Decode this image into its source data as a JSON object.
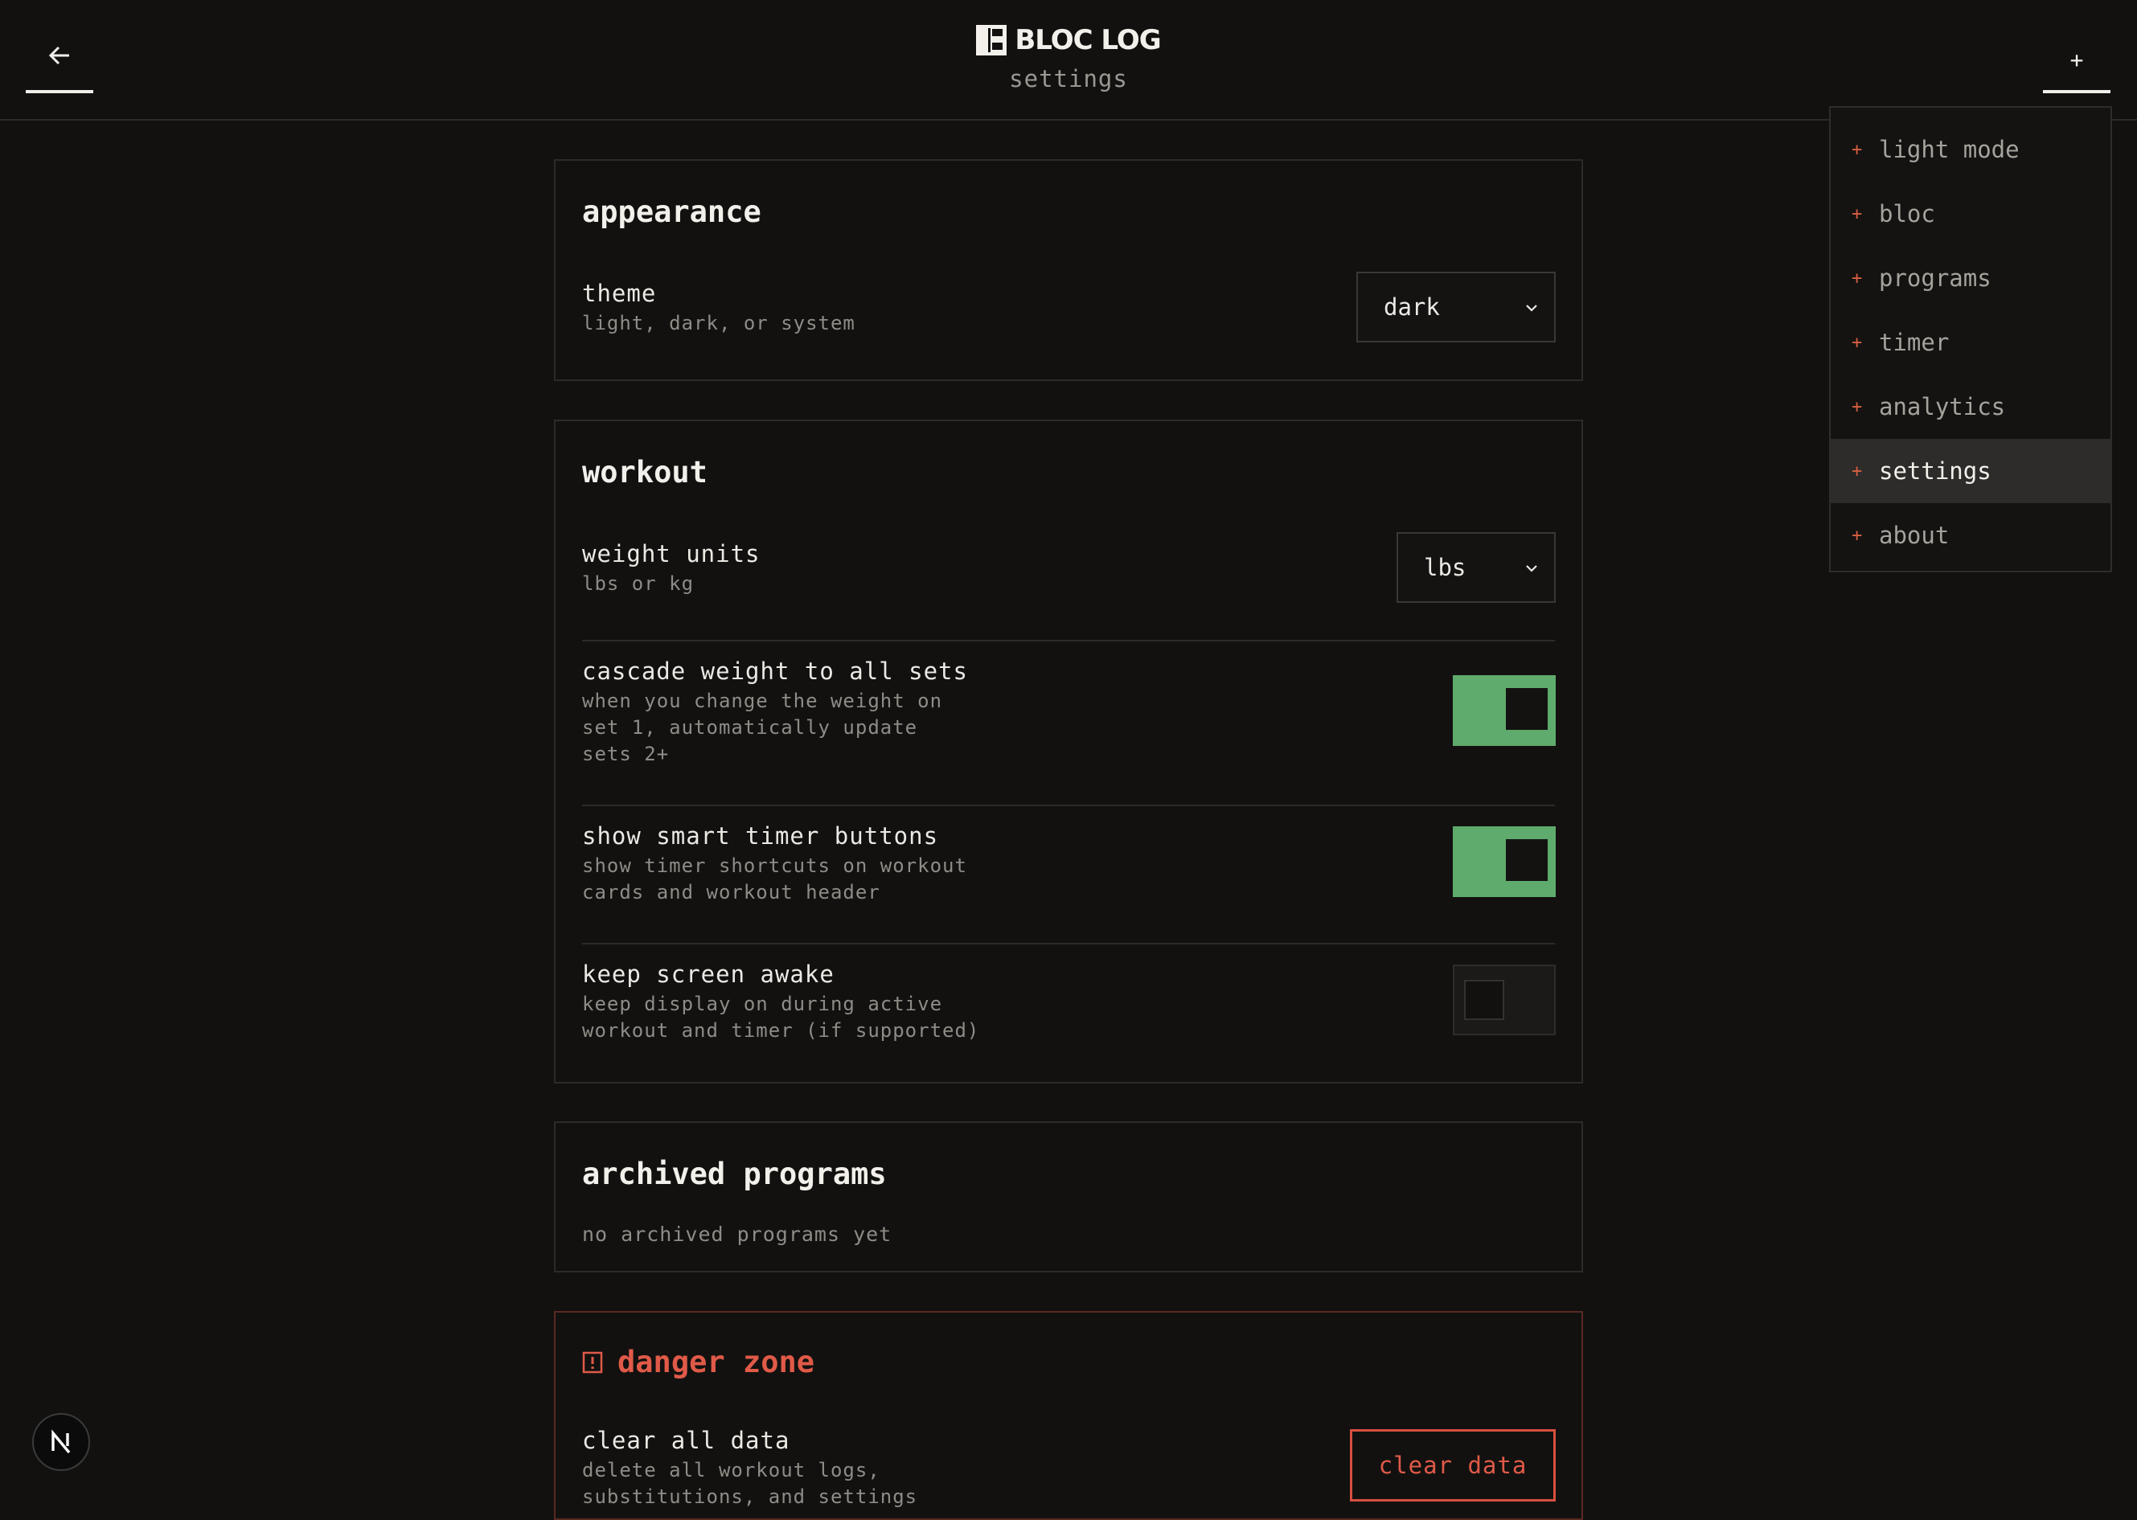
{
  "header": {
    "brand": "BLOC LOG",
    "subtitle": "settings",
    "menu_button_label": "+"
  },
  "nav_menu": {
    "items": [
      {
        "label": "light mode",
        "active": false
      },
      {
        "label": "bloc",
        "active": false
      },
      {
        "label": "programs",
        "active": false
      },
      {
        "label": "timer",
        "active": false
      },
      {
        "label": "analytics",
        "active": false
      },
      {
        "label": "settings",
        "active": true
      },
      {
        "label": "about",
        "active": false
      }
    ]
  },
  "appearance": {
    "title": "appearance",
    "theme_label": "theme",
    "theme_desc": "light, dark, or system",
    "theme_value": "dark"
  },
  "workout": {
    "title": "workout",
    "weight_units_label": "weight units",
    "weight_units_desc": "lbs or kg",
    "weight_units_value": "lbs",
    "cascade_label": "cascade weight to all sets",
    "cascade_desc": "when you change the weight on\nset 1, automatically update\nsets 2+",
    "cascade_on": true,
    "smart_timer_label": "show smart timer buttons",
    "smart_timer_desc": "show timer shortcuts on workout\ncards and workout header",
    "smart_timer_on": true,
    "awake_label": "keep screen awake",
    "awake_desc": "keep display on during active\nworkout and timer (if supported)",
    "awake_on": false
  },
  "archived": {
    "title": "archived programs",
    "empty_text": "no archived programs yet"
  },
  "danger": {
    "title": "danger zone",
    "clear_label": "clear all data",
    "clear_desc": "delete all workout logs,\nsubstitutions, and settings",
    "clear_button": "clear data"
  },
  "colors": {
    "background": "#121110",
    "accent_green": "#5fab6d",
    "danger_red": "#e05a48",
    "nav_plus": "#d65f42"
  },
  "icons": {
    "back": "arrow-left-icon",
    "logo": "bloc-logo-icon",
    "danger": "alert-square-icon",
    "chevron": "chevron-down-icon",
    "next_badge": "next-n-icon"
  }
}
